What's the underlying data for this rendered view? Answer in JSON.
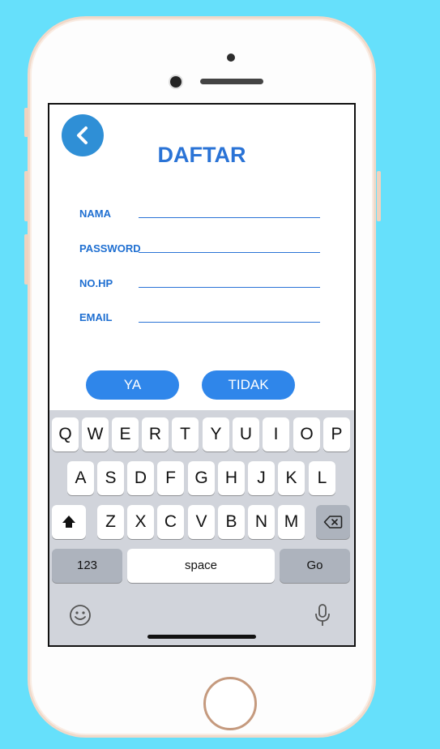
{
  "header": {
    "title": "DAFTAR"
  },
  "form": {
    "fields": [
      {
        "label": "NAMA"
      },
      {
        "label": "PASSWORD"
      },
      {
        "label": "NO.HP"
      },
      {
        "label": "EMAIL"
      }
    ],
    "yes_label": "YA",
    "no_label": "TIDAK"
  },
  "keyboard": {
    "row1": [
      "Q",
      "W",
      "E",
      "R",
      "T",
      "Y",
      "U",
      "I",
      "O",
      "P"
    ],
    "row2": [
      "A",
      "S",
      "D",
      "F",
      "G",
      "H",
      "J",
      "K",
      "L"
    ],
    "row3": [
      "Z",
      "X",
      "C",
      "V",
      "B",
      "N",
      "M"
    ],
    "numbers_label": "123",
    "space_label": "space",
    "go_label": "Go"
  },
  "colors": {
    "accent": "#2a73d6",
    "button": "#2f86ea",
    "background": "#66e0fb"
  }
}
